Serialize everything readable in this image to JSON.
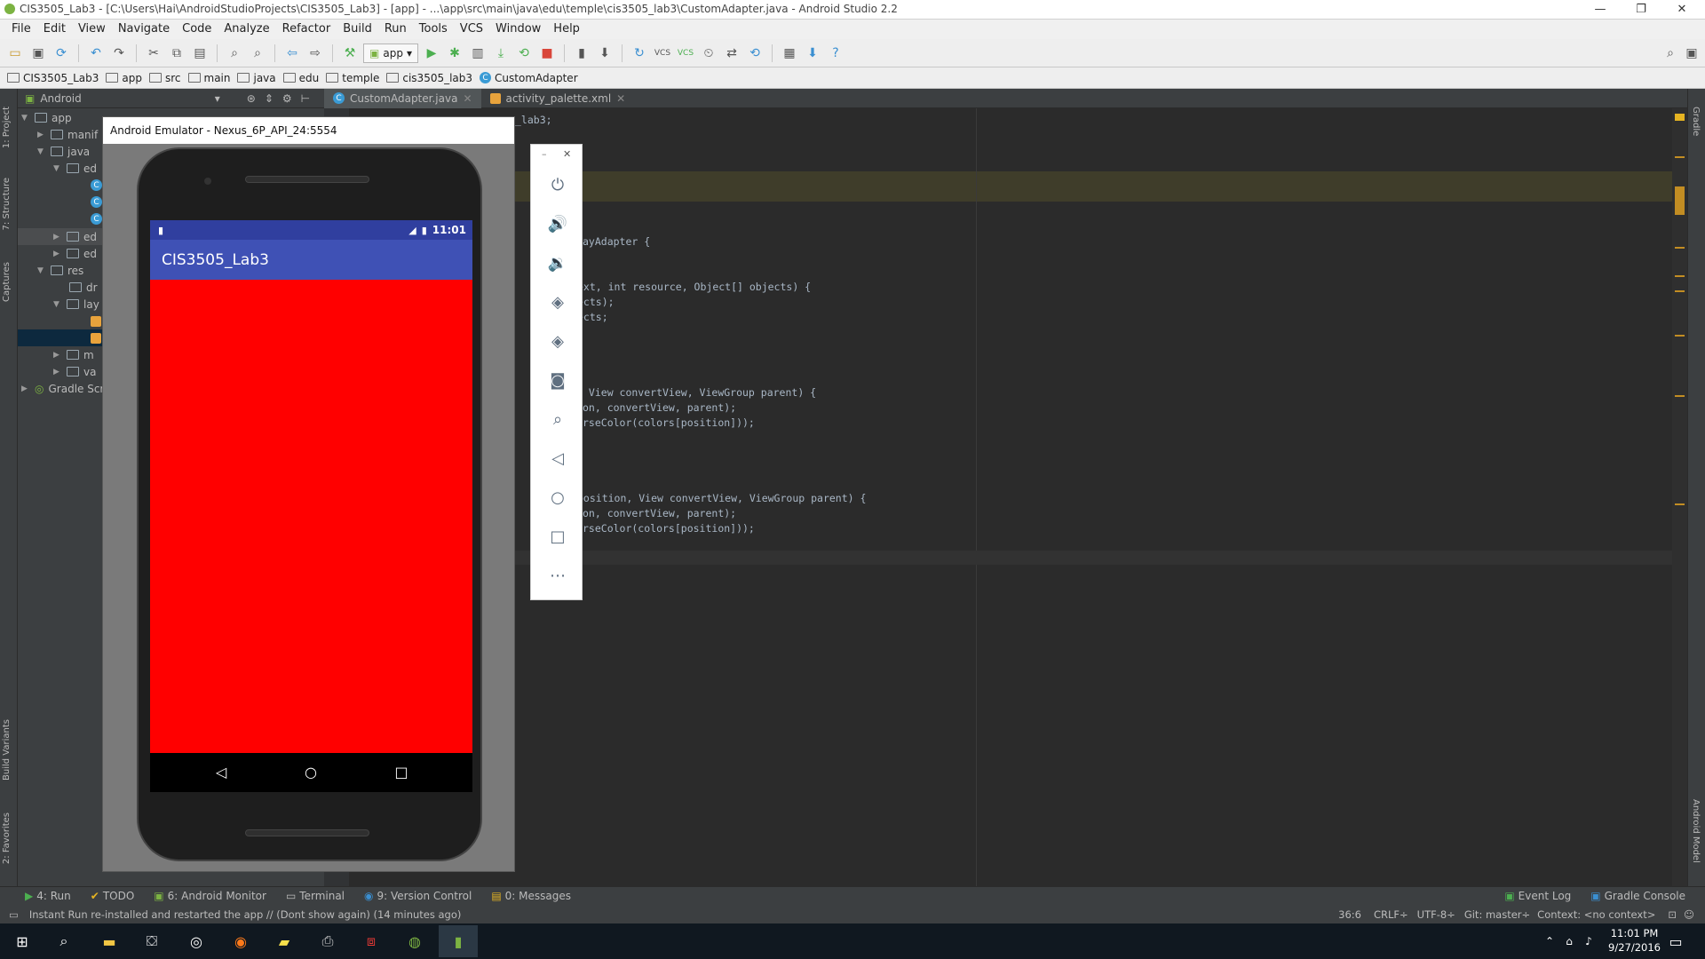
{
  "window": {
    "title": "CIS3505_Lab3 - [C:\\Users\\Hai\\AndroidStudioProjects\\CIS3505_Lab3] - [app] - ...\\app\\src\\main\\java\\edu\\temple\\cis3505_lab3\\CustomAdapter.java - Android Studio 2.2",
    "min": "—",
    "max": "❐",
    "close": "✕"
  },
  "menu": [
    "File",
    "Edit",
    "View",
    "Navigate",
    "Code",
    "Analyze",
    "Refactor",
    "Build",
    "Run",
    "Tools",
    "VCS",
    "Window",
    "Help"
  ],
  "toolbar": {
    "run_config": "app"
  },
  "breadcrumb": [
    "CIS3505_Lab3",
    "app",
    "src",
    "main",
    "java",
    "edu",
    "temple",
    "cis3505_lab3",
    "CustomAdapter"
  ],
  "project_panel": {
    "view_mode": "Android",
    "tree": [
      "app",
      "manif",
      "java",
      "ed",
      "ed",
      "ed",
      "res",
      "dr",
      "lay",
      "m",
      "va",
      "Gradle Scr"
    ]
  },
  "editor_tabs": [
    {
      "label": "CustomAdapter.java",
      "active": true
    },
    {
      "label": "activity_palette.xml",
      "active": false
    }
  ],
  "code": {
    "l1": "_lab3;",
    "l2": "ayAdapter {",
    "l3": "ext, int resource, Object[] objects) {",
    "l4": "ects);",
    "l5": "ects;",
    "l6": " View convertView, ViewGroup parent) {",
    "l7": "on, convertView, parent);",
    "l8": "rseColor(colors[position]));",
    "l9": "position, View convertView, ViewGroup parent) {",
    "l10": "on, convertView, parent);",
    "l11": "rseColor(colors[position]));"
  },
  "emulator": {
    "title": "Android Emulator - Nexus_6P_API_24:5554",
    "status_time": "11:01",
    "app_title": "CIS3505_Lab3",
    "screen_color": "#ff0000",
    "appbar_color": "#3f51b5"
  },
  "side_tabs": {
    "left": [
      "1: Project",
      "7: Structure",
      "Captures",
      "Build Variants",
      "2: Favorites"
    ],
    "right": [
      "Gradle",
      "Android Model"
    ]
  },
  "bottom_tabs": [
    "4: Run",
    "TODO",
    "6: Android Monitor",
    "Terminal",
    "9: Version Control",
    "0: Messages"
  ],
  "bottom_right": [
    "Event Log",
    "Gradle Console"
  ],
  "status": {
    "message": "Instant Run re-installed and restarted the app // (Dont show again) (14 minutes ago)",
    "position": "36:6",
    "line_sep": "CRLF÷",
    "encoding": "UTF-8÷",
    "git": "Git: master÷",
    "context": "Context: <no context>"
  },
  "taskbar": {
    "time": "11:01 PM",
    "date": "9/27/2016"
  }
}
